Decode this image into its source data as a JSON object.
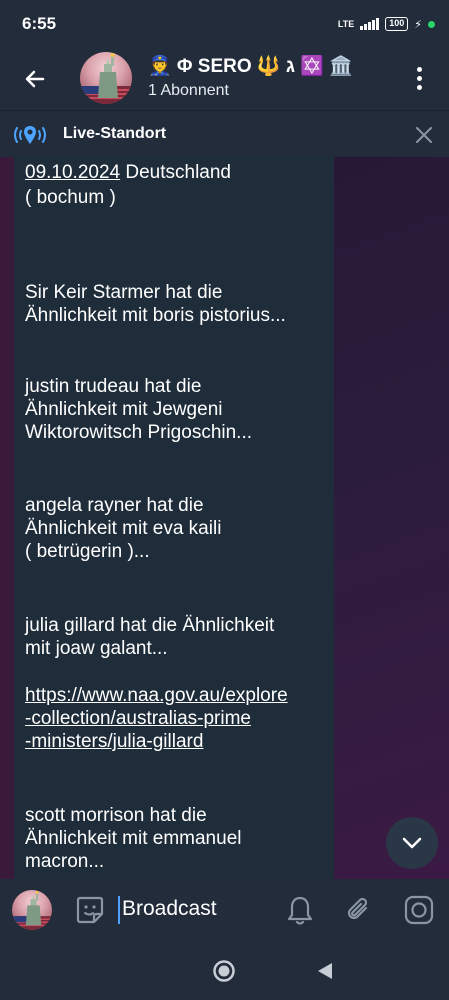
{
  "status_bar": {
    "time": "6:55",
    "network": "LTE",
    "battery": "100"
  },
  "header": {
    "title": "👮 Φ SERO 🔱 ג ✡️ 🏛️",
    "subtitle": "1 Abonnent"
  },
  "live_location": {
    "label": "Live-Standort"
  },
  "messages": {
    "date_link": "09.10.2024",
    "line1_rest": " Deutschland",
    "line2": "( bochum )",
    "block1": "Sir Keir Starmer hat die\nÄhnlichkeit mit boris pistorius...",
    "block2": "justin trudeau hat die\nÄhnlichkeit mit Jewgeni\nWiktorowitsch Prigoschin...",
    "block3": "angela rayner hat die\nÄhnlichkeit mit eva kaili\n( betrügerin )...",
    "block4": "julia gillard hat die Ähnlichkeit\nmit joaw galant...",
    "url": "https://www.naa.gov.au/explore\n-collection/australias-prime\n-ministers/julia-gillard",
    "block5": "scott morrison hat die\nÄhnlichkeit mit emmanuel\nmacron..."
  },
  "input": {
    "value": "Broadcast"
  },
  "colors": {
    "accent": "#4da3ff",
    "header_bg": "#222c3a",
    "bubble_bg": "#1f2c3a"
  },
  "icons": {
    "back": "arrow-left-icon",
    "menu": "more-vertical-icon",
    "live": "location-broadcast-icon",
    "close": "close-icon",
    "scroll": "chevron-down-icon",
    "sticker": "sticker-icon",
    "bell": "bell-icon",
    "attach": "paperclip-icon",
    "camera": "camera-icon"
  }
}
